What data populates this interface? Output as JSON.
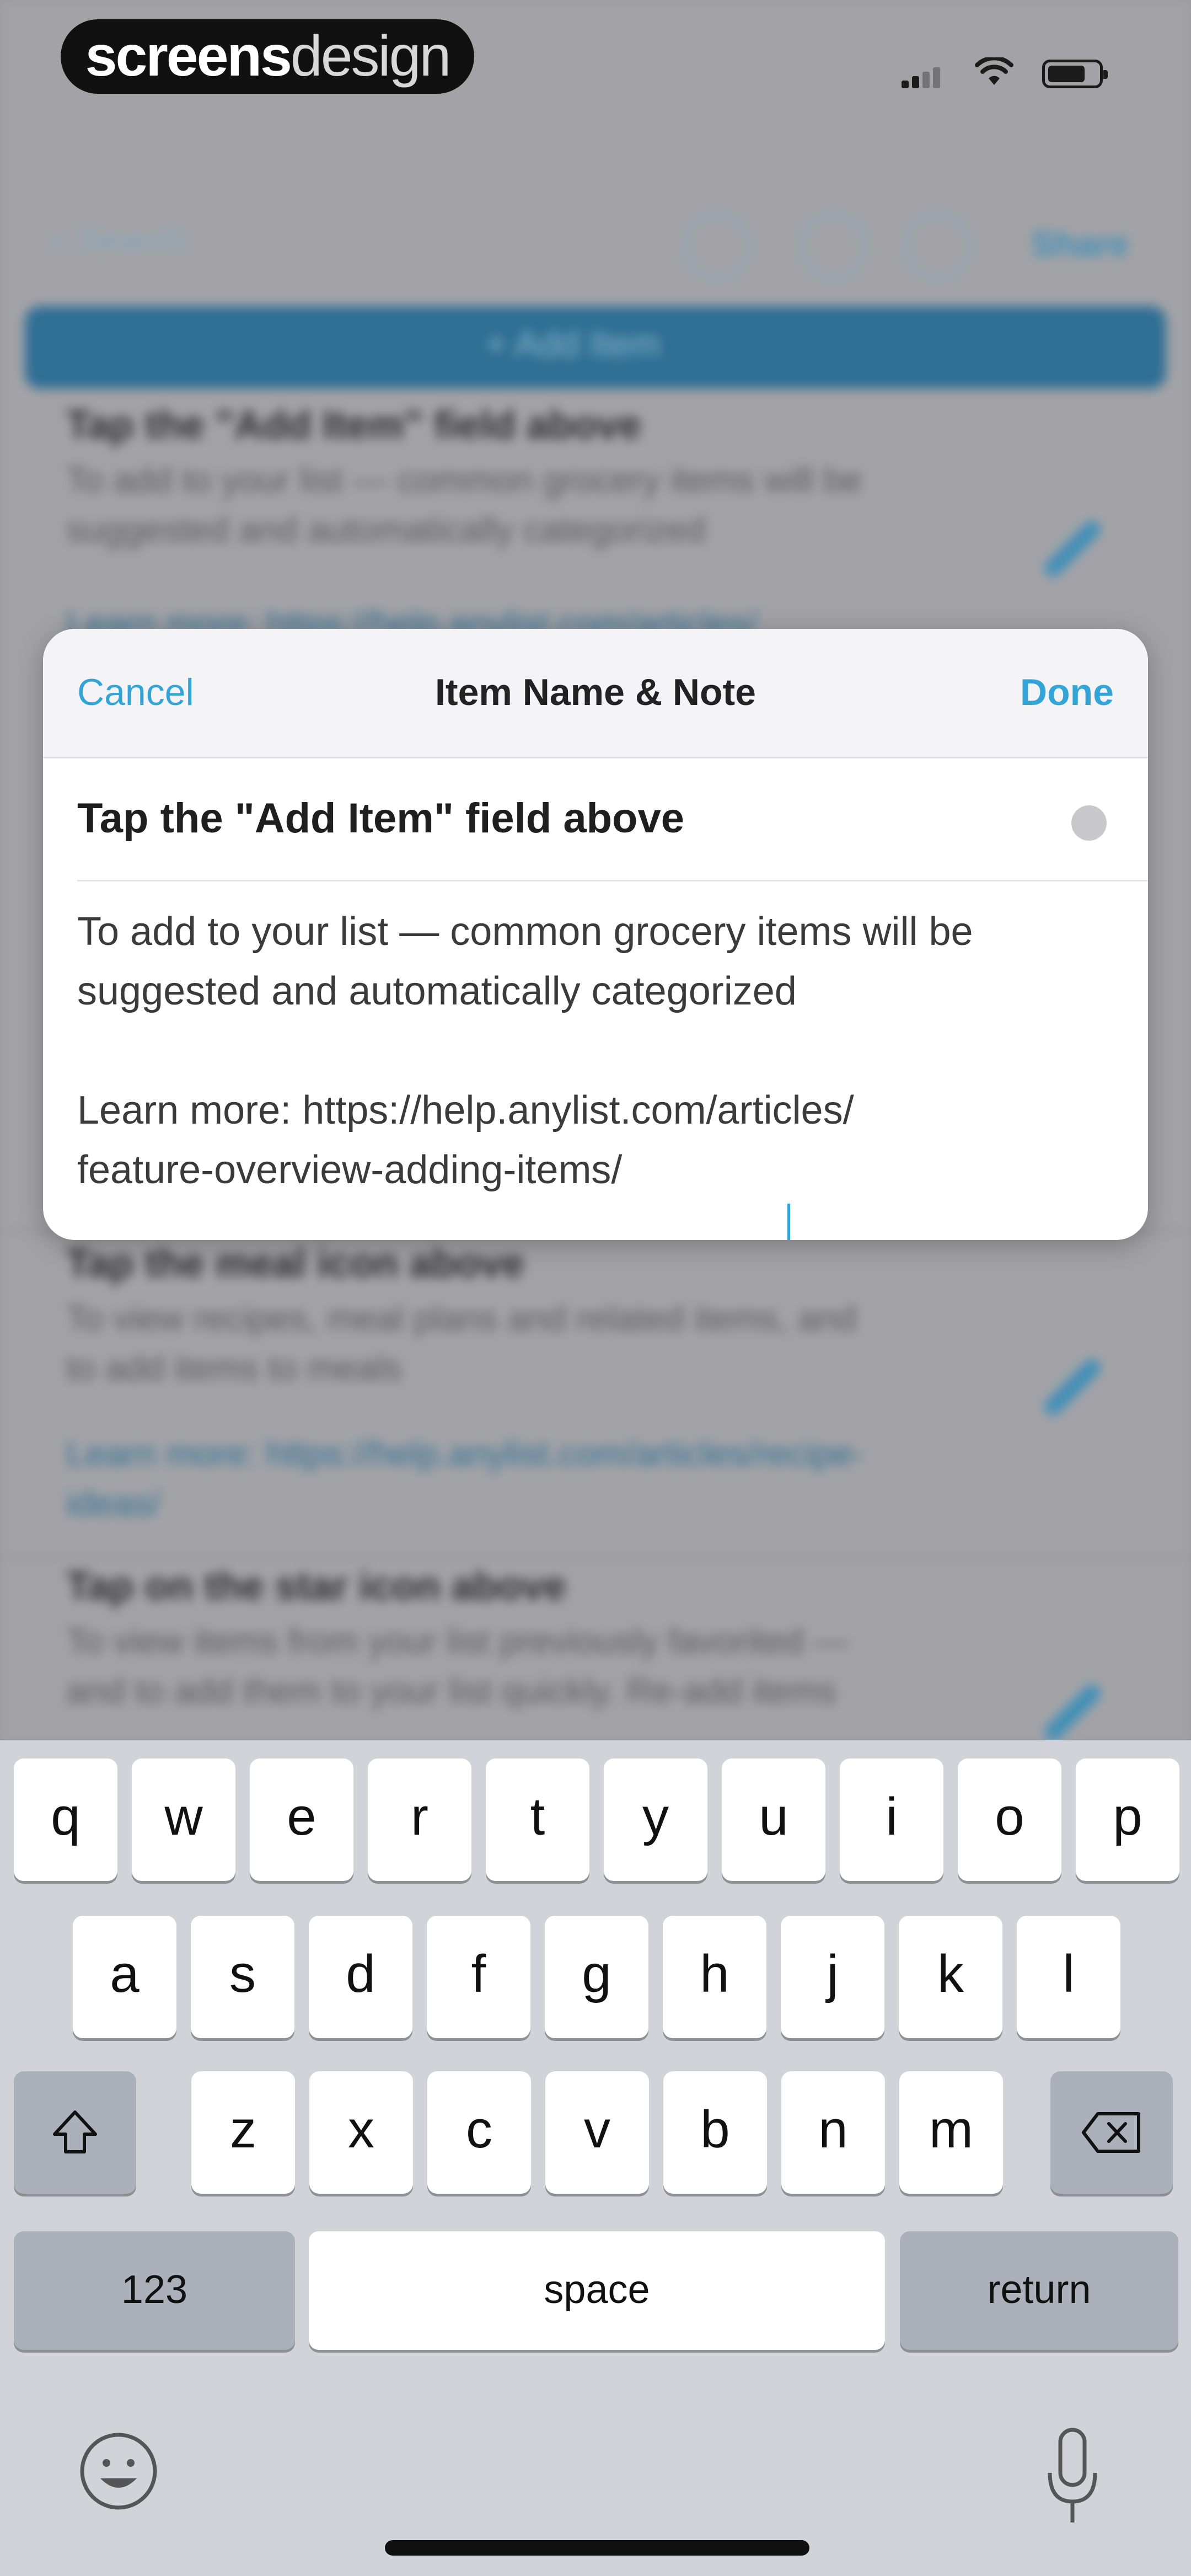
{
  "watermark": {
    "part1": "screens",
    "part2": "design"
  },
  "status_bar": {
    "signal_bars": 2,
    "battery_level": 0.75
  },
  "background": {
    "search_placeholder": "Search",
    "share_label": "Share",
    "add_item_label": "Add Item",
    "rows": [
      {
        "title": "Tap the \"Add Item\" field above",
        "note": "To add to your list — common grocery items will be suggested and automatically categorized",
        "link": "Learn more: https://help.anylist.com/articles/"
      },
      {
        "title": "Tap the meal icon above",
        "note": "To view recipes, meal plans and related items, and to add items to meals",
        "link": "Learn more: https://help.anylist.com/articles/recipe-ideas/"
      },
      {
        "title": "Tap on the star icon above",
        "note": "To view items from your list previously favorited — and to add them to your list quickly. Re-add items",
        "link": ""
      }
    ]
  },
  "modal": {
    "cancel_label": "Cancel",
    "title": "Item Name & Note",
    "done_label": "Done",
    "item_name": "Tap the \"Add Item\" field above",
    "note_line1": "To add to your list — common grocery items will be",
    "note_line2": "suggested and automatically categorized",
    "note_line3": "Learn more: https://help.anylist.com/articles/",
    "note_line4": "feature-overview-adding-items/"
  },
  "keyboard": {
    "row1": [
      "q",
      "w",
      "e",
      "r",
      "t",
      "y",
      "u",
      "i",
      "o",
      "p"
    ],
    "row2": [
      "a",
      "s",
      "d",
      "f",
      "g",
      "h",
      "j",
      "k",
      "l"
    ],
    "row3": [
      "z",
      "x",
      "c",
      "v",
      "b",
      "n",
      "m"
    ],
    "numbers_label": "123",
    "space_label": "space",
    "return_label": "return",
    "icons": {
      "shift": "shift-icon",
      "delete": "delete-icon",
      "emoji": "emoji-icon",
      "mic": "microphone-icon"
    }
  },
  "colors": {
    "accent": "#34a4d6",
    "keyboard_bg": "#d2d3d8",
    "function_key": "#acb0bb"
  }
}
